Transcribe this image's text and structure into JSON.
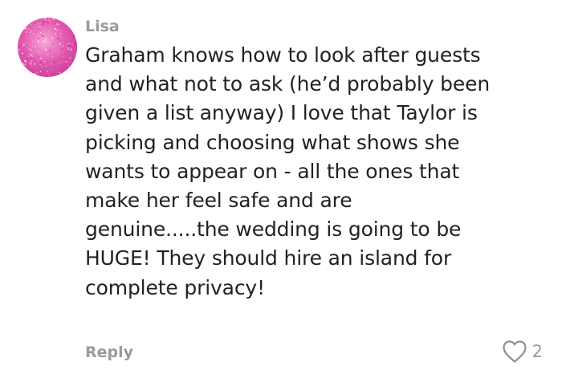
{
  "comment": {
    "author": "Lisa",
    "text_lines": [
      "Graham knows how to look after guests",
      "and what not to ask (he’d probably been",
      "given a list anyway) I love that Taylor is",
      "picking and choosing what shows she",
      "wants to appear on - all the ones that",
      "make her feel safe and are",
      "genuine.....the wedding is going to be",
      "HUGE! They should hire an island for",
      "complete privacy!"
    ],
    "reply_label": "Reply",
    "like_count": "2",
    "avatar_icon": "pink-glitter-avatar",
    "like_icon": "heart-outline-icon"
  },
  "colors": {
    "meta_text": "#9a9a9a",
    "body_text": "#222222",
    "avatar_pink": "#e35ab0"
  }
}
